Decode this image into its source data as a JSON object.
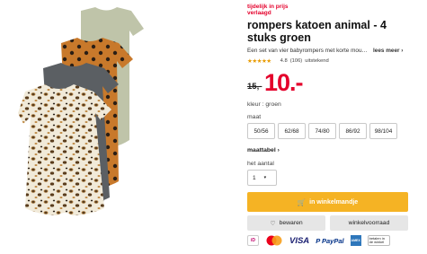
{
  "product": {
    "promo_badge": "tijdelijk in prijs verlaagd",
    "title": "rompers katoen animal - 4 stuks groen",
    "description": "Een set van vier babyrompers met korte mouwen",
    "read_more": "lees meer",
    "read_more_chevron": "›",
    "rating_stars": "★★★★★",
    "rating_value": "4.8",
    "review_count": "(106)",
    "rating_label": "uitstekend",
    "old_price": "15,-",
    "new_price": "10.-"
  },
  "options": {
    "color_label": "kleur : groen",
    "size_label": "maat",
    "sizes": [
      "50/56",
      "62/68",
      "74/80",
      "86/92",
      "98/104"
    ],
    "size_table_label": "maattabel",
    "size_table_chevron": "›",
    "qty_label": "het aantal",
    "qty_value": "1",
    "qty_chevron": "▾"
  },
  "actions": {
    "cart_icon": "🛒",
    "cart_label": "in winkelmandje",
    "save_icon": "♡",
    "save_label": "bewaren",
    "stock_label": "winkelvoorraad"
  },
  "payments": {
    "ideal": "iD",
    "visa": "VISA",
    "paypal": "P PayPal",
    "amex": "AMEX",
    "later": "betalen in de winkel"
  },
  "colors": {
    "accent_red": "#e4002b",
    "cart_yellow": "#f5b324",
    "star_orange": "#e89a00"
  },
  "icons": [
    "cart-icon",
    "heart-icon",
    "chevron-right-icon",
    "chevron-down-icon"
  ]
}
